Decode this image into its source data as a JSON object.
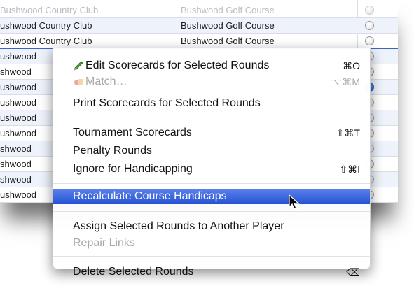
{
  "rows": [
    {
      "club": "Bushwood Country Club",
      "course": "Bushwood Golf Course",
      "style": "faded"
    },
    {
      "club": "ushwood Country Club",
      "course": "Bushwood Golf Course",
      "style": "alt"
    },
    {
      "club": "ushwood Country Club",
      "course": "Bushwood Golf Course",
      "style": ""
    },
    {
      "club": "ushwood",
      "course": "",
      "style": "alt"
    },
    {
      "club": "shwood",
      "course": "",
      "style": ""
    },
    {
      "club": "ushwood",
      "course": "",
      "style": "alt"
    },
    {
      "club": "ushwood",
      "course": "",
      "style": ""
    },
    {
      "club": "ushwood",
      "course": "",
      "style": "alt"
    },
    {
      "club": "ushwood",
      "course": "",
      "style": ""
    },
    {
      "club": "shwood",
      "course": "",
      "style": "alt"
    },
    {
      "club": "shwood",
      "course": "",
      "style": ""
    },
    {
      "club": "shwood",
      "course": "",
      "style": "alt"
    },
    {
      "club": "ushwood",
      "course": "",
      "style": ""
    }
  ],
  "menu": {
    "edit_scorecards": {
      "label": "Edit Scorecards for Selected Rounds",
      "shortcut": "⌘O",
      "icon": "pencil-icon"
    },
    "match": {
      "label": "Match…",
      "shortcut": "⌥⌘M",
      "icon": "match-icon"
    },
    "print_scorecards": {
      "label": "Print Scorecards for Selected Rounds"
    },
    "tournament_scorecards": {
      "label": "Tournament Scorecards",
      "shortcut": "⇧⌘T"
    },
    "penalty_rounds": {
      "label": "Penalty Rounds"
    },
    "ignore_handicapping": {
      "label": "Ignore for Handicapping",
      "shortcut": "⇧⌘I"
    },
    "recalculate": {
      "label": "Recalculate Course Handicaps"
    },
    "assign_rounds": {
      "label": "Assign Selected Rounds to Another Player"
    },
    "repair_links": {
      "label": "Repair Links"
    },
    "delete_rounds": {
      "label": "Delete Selected Rounds",
      "shortcut": "⌫"
    }
  },
  "colors": {
    "highlight": "#2552d4",
    "disabled_text": "#a8a8a8",
    "row_alt": "#edf2fb"
  }
}
